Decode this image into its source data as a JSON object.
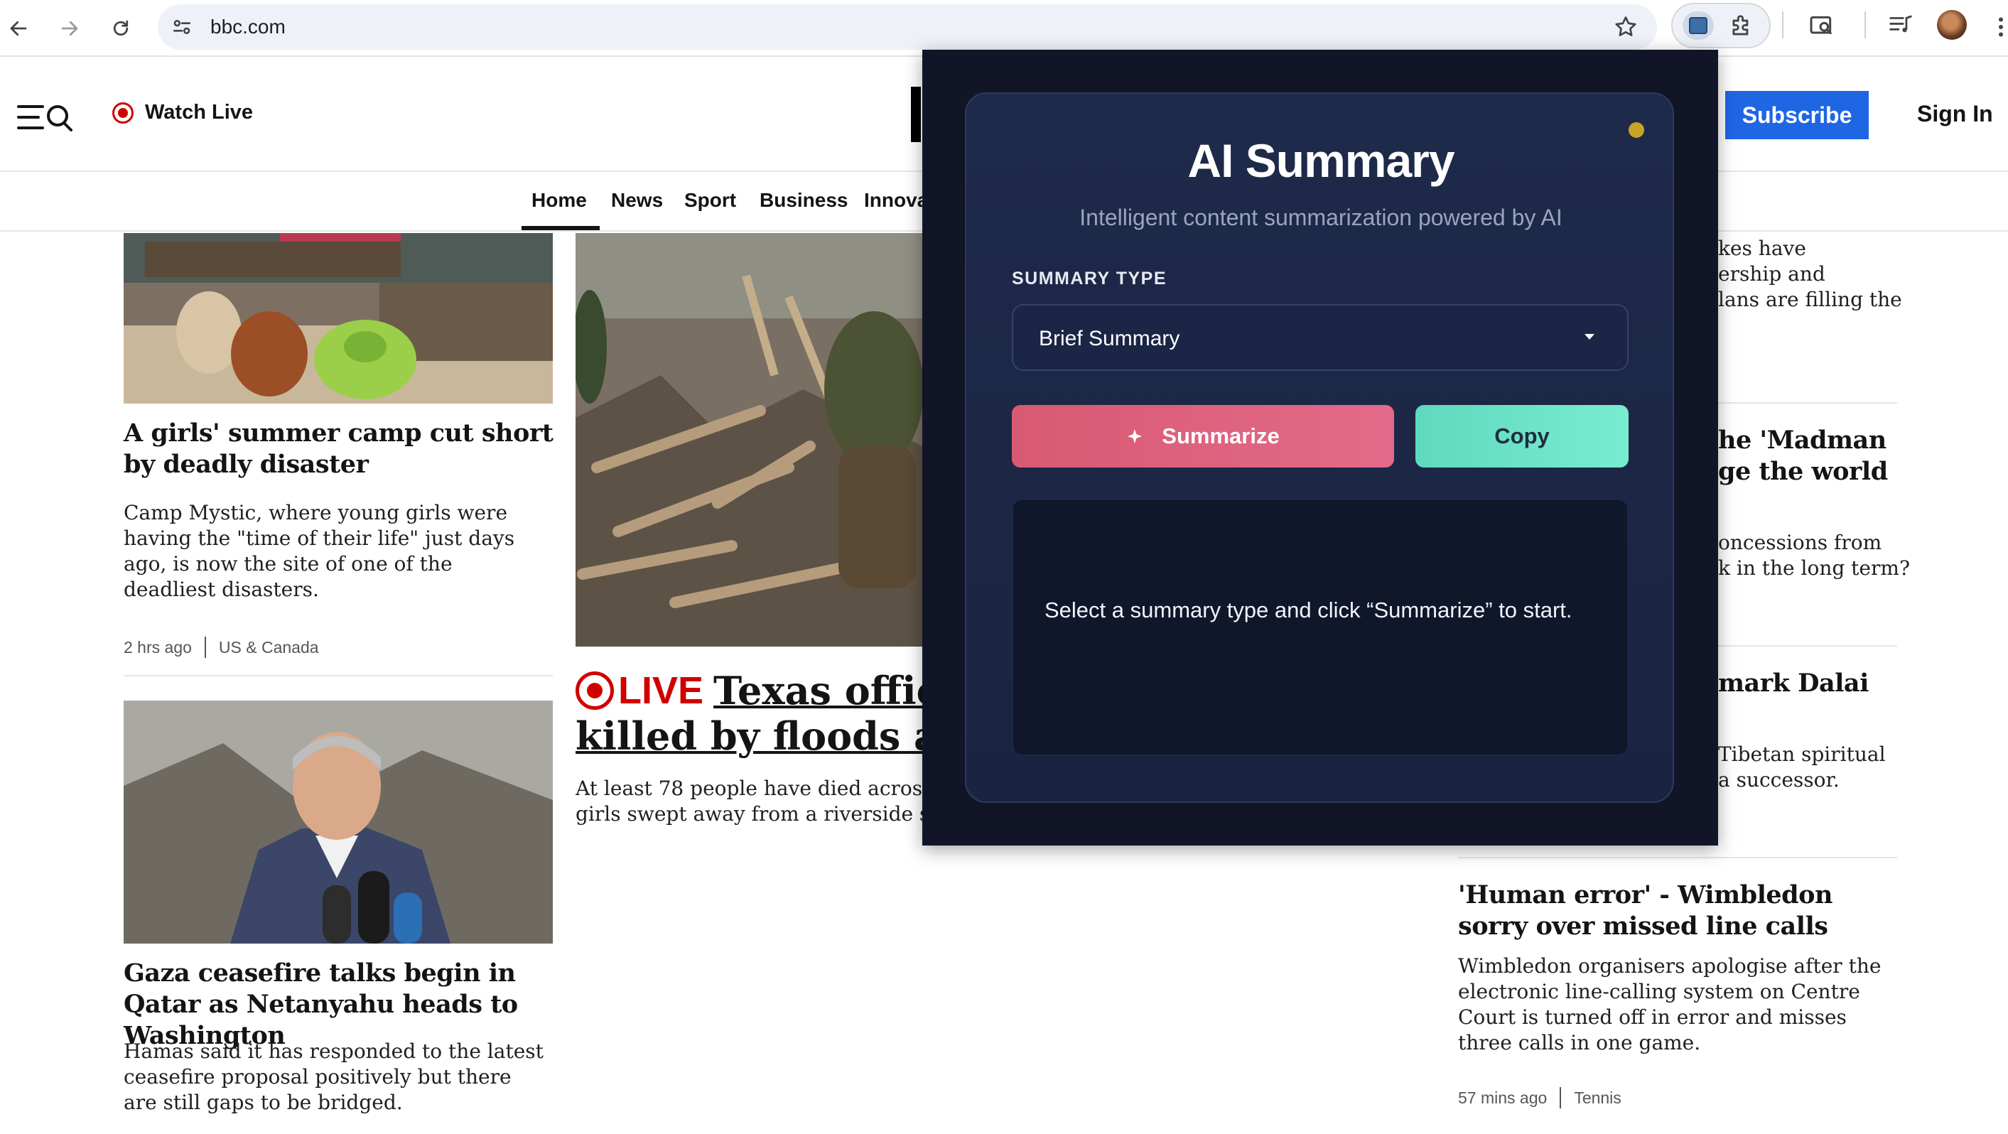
{
  "browser": {
    "url": "bbc.com",
    "icons": [
      "back-arrow-icon",
      "forward-arrow-icon",
      "reload-icon",
      "site-settings-icon",
      "bookmark-star-icon",
      "extension-active-icon",
      "puzzle-extensions-icon",
      "tab-search-icon",
      "media-controls-icon",
      "profile-avatar",
      "more-menu-icon"
    ]
  },
  "header": {
    "watch_live": "Watch Live",
    "subscribe": "Subscribe",
    "sign_in": "Sign In"
  },
  "nav": {
    "items": [
      "Home",
      "News",
      "Sport",
      "Business",
      "Innova"
    ]
  },
  "articles": {
    "camp": {
      "headline": "A girls' summer camp cut short by deadly disaster",
      "summary": "Camp Mystic, where young girls were having the \"time of their life\" just days ago, is now the site of one of the deadliest disasters.",
      "time": "2 hrs ago",
      "section": "US & Canada"
    },
    "gaza": {
      "headline": "Gaza ceasefire talks begin in Qatar as Netanyahu heads to Washington",
      "summary": "Hamas said it has responded to the latest ceasefire proposal positively but there are still gaps to be bridged."
    },
    "live": {
      "tag": "LIVE",
      "headline_line1": "Texas offic",
      "headline_line2": "killed by floods as",
      "summary_line1": "At least 78 people have died across f",
      "summary_line2": "girls swept away from a riverside su"
    },
    "right_fragments": {
      "a1": "kes have",
      "a2": "ership and",
      "a3": "lans are filling the",
      "b1": "he 'Madman",
      "b2": "ge the world",
      "b3": "oncessions from",
      "b4": "k in the long term?",
      "c1": "mark Dalai",
      "c2": "Tibetan spiritual",
      "c3": "a successor."
    },
    "wimbledon": {
      "headline": "'Human error' - Wimbledon sorry over missed line calls",
      "summary": "Wimbledon organisers apologise after the electronic line-calling system on Centre Court is turned off in error and misses three calls in one game.",
      "time": "57 mins ago",
      "section": "Tennis"
    }
  },
  "extension": {
    "title": "AI Summary",
    "subtitle": "Intelligent content summarization powered by AI",
    "field_label": "SUMMARY TYPE",
    "selected_type": "Brief Summary",
    "summarize_label": "Summarize",
    "copy_label": "Copy",
    "output_placeholder": "Select a summary type and click “Summarize” to start.",
    "colors": {
      "summarize": "#e0647e",
      "copy": "#6ee4c6",
      "status_dot": "#c9a227"
    }
  }
}
